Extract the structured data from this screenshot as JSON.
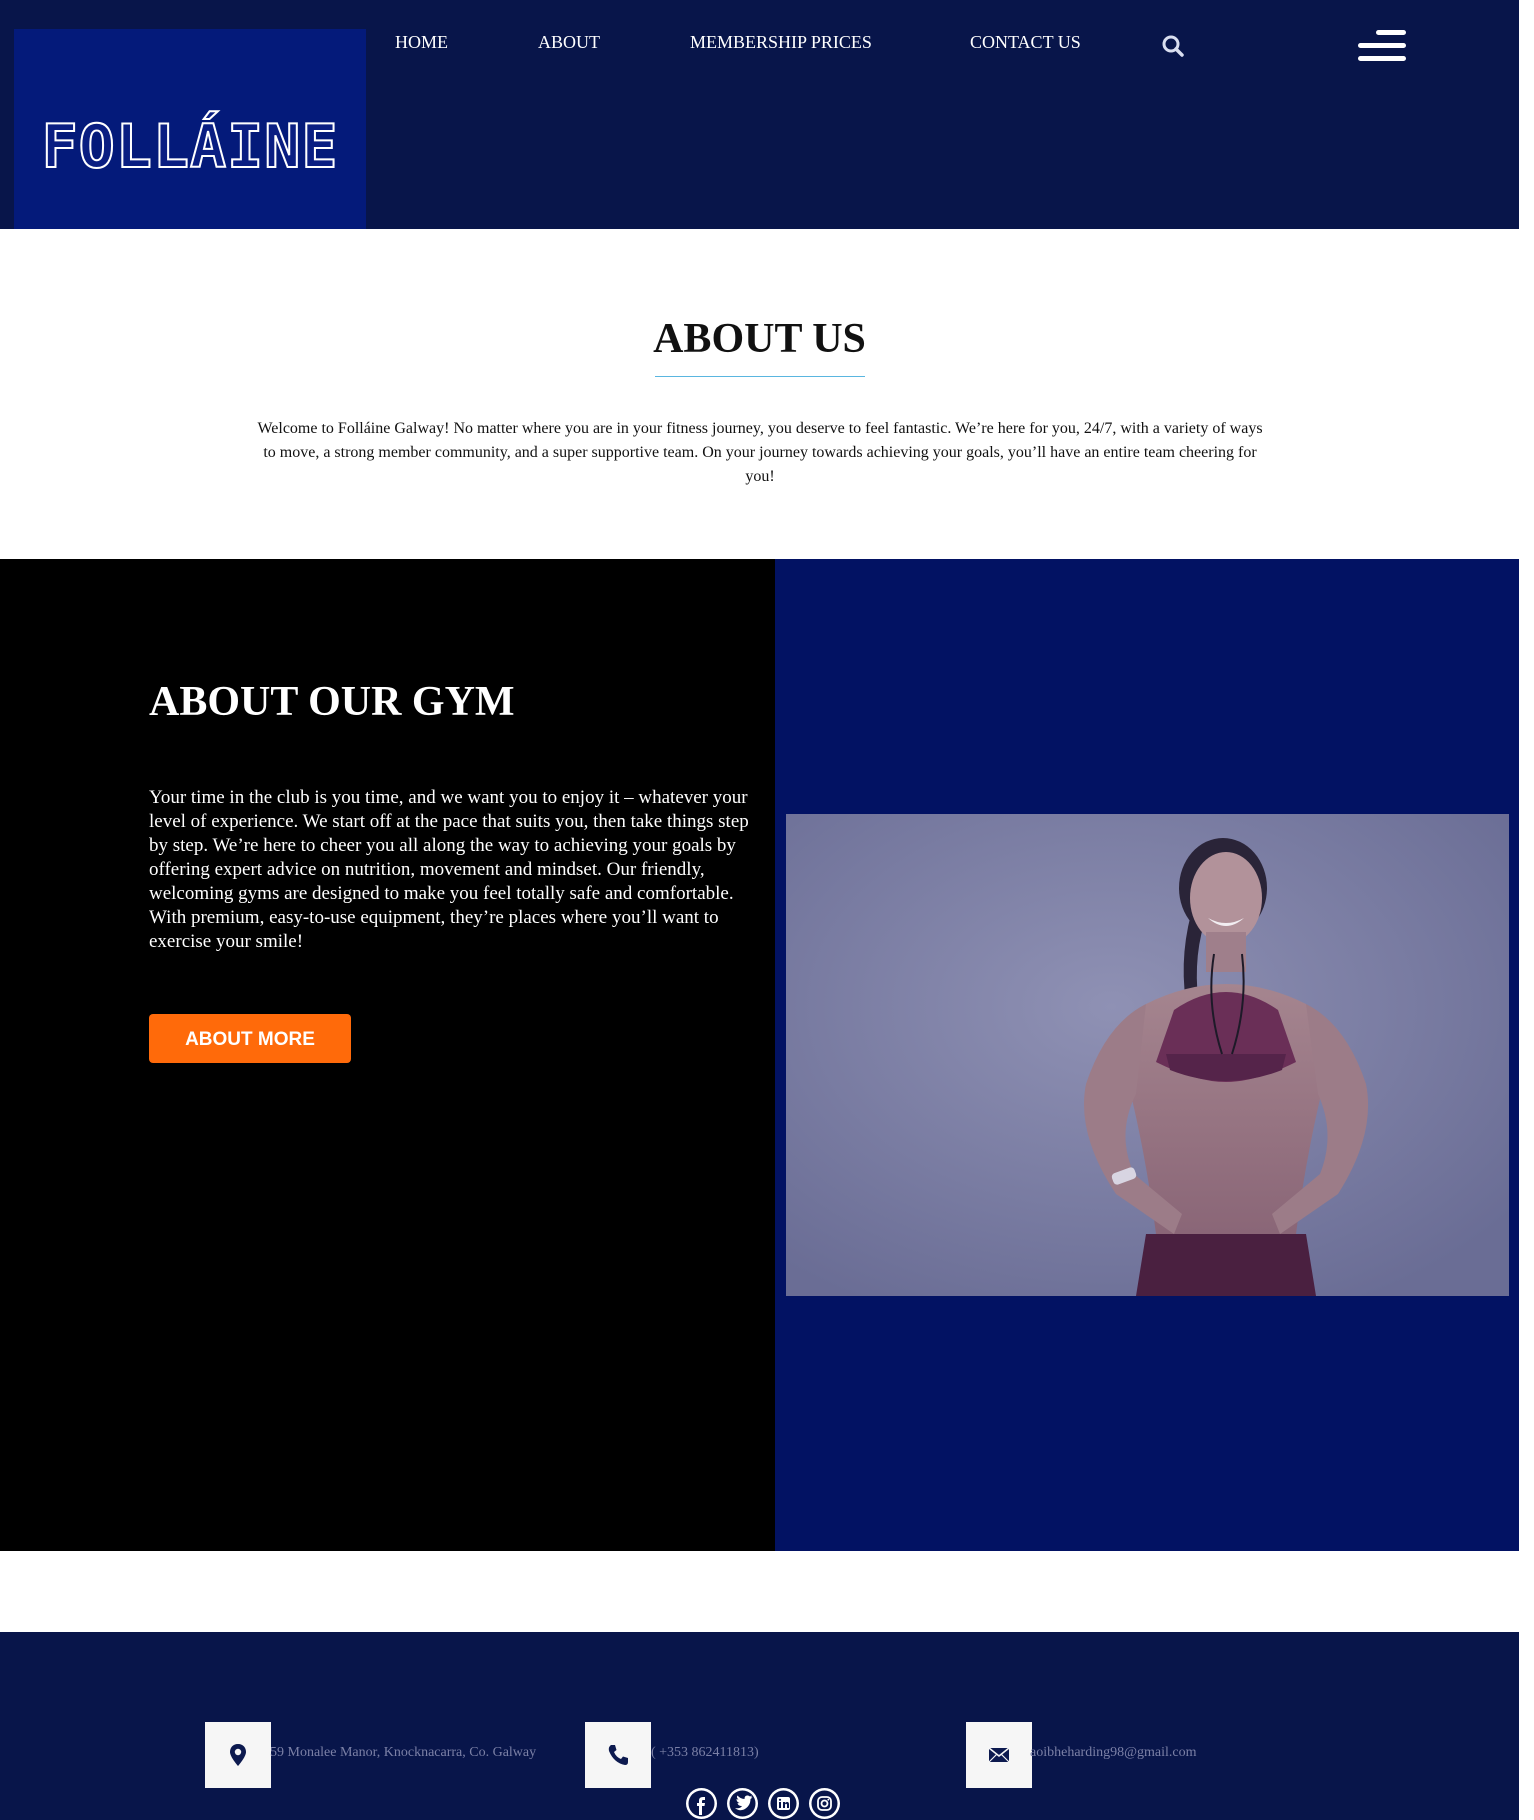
{
  "header": {
    "logo_text": "FOLLÁINE",
    "nav": [
      {
        "label": "HOME"
      },
      {
        "label": "ABOUT"
      },
      {
        "label": "MEMBERSHIP PRICES"
      },
      {
        "label": "CONTACT US"
      }
    ],
    "icons": [
      "search-icon",
      "hamburger-menu-icon"
    ]
  },
  "about": {
    "title": "ABOUT US",
    "text": "Welcome to Folláine Galway! No matter where you are in your fitness journey, you deserve to feel fantastic. We’re here for you, 24/7, with a variety of ways to move, a strong member community, and a super supportive team. On your journey towards achieving your goals, you’ll have an entire team cheering for you!"
  },
  "gym": {
    "title": "ABOUT OUR GYM",
    "text": "Your time in the club is you time, and we want you to enjoy it – whatever your level of experience. We start off at the pace that suits you, then take things step by step. We’re here to cheer you all along the way to achieving your goals by offering expert advice on nutrition, movement and mindset. Our friendly, welcoming gyms are designed to make you feel totally safe and comfortable. With premium, easy-to-use equipment, they’re places where you’ll want to exercise your smile!",
    "button_label": "ABOUT MORE",
    "image": "woman-in-sports-bra-photo"
  },
  "footer": {
    "address": "59 Monalee Manor, Knocknacarra, Co. Galway",
    "phone": "( +353 862411813)",
    "email": "aoibheharding98@gmail.com",
    "social": [
      "facebook-icon",
      "twitter-icon",
      "linkedin-icon",
      "instagram-icon"
    ]
  },
  "colors": {
    "header_bg": "#08154a",
    "logo_bg": "#041a7a",
    "gym_right_bg": "#021263",
    "button": "#ff6a0a",
    "underline": "#5ab6e0"
  }
}
